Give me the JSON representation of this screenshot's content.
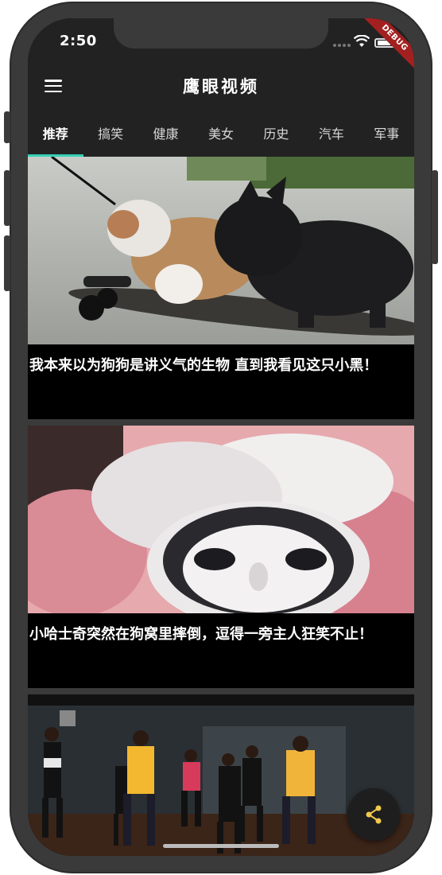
{
  "status_bar": {
    "time": "2:50",
    "debug_label": "DEBUG"
  },
  "app_bar": {
    "title": "鹰眼视频",
    "menu_icon": "menu-icon"
  },
  "tabs": [
    {
      "label": "推荐",
      "active": true
    },
    {
      "label": "搞笑"
    },
    {
      "label": "健康"
    },
    {
      "label": "美女"
    },
    {
      "label": "历史"
    },
    {
      "label": "汽车"
    },
    {
      "label": "军事"
    }
  ],
  "feed": {
    "videos": [
      {
        "caption": "我本来以为狗狗是讲义气的生物 直到我看见这只小黑！",
        "thumbnail": "two dogs riding a skateboard"
      },
      {
        "caption": "小哈士奇突然在狗窝里摔倒，逗得一旁主人狂笑不止！",
        "thumbnail": "husky puppy lying in a pink bed"
      },
      {
        "caption": "",
        "thumbnail": "kids dancing in a dance studio"
      }
    ]
  },
  "share_button": {
    "icon": "share-icon"
  },
  "colors": {
    "app_bar": "#222222",
    "tab_indicator": "#36d0b5",
    "frame": "#3a3a3a"
  }
}
